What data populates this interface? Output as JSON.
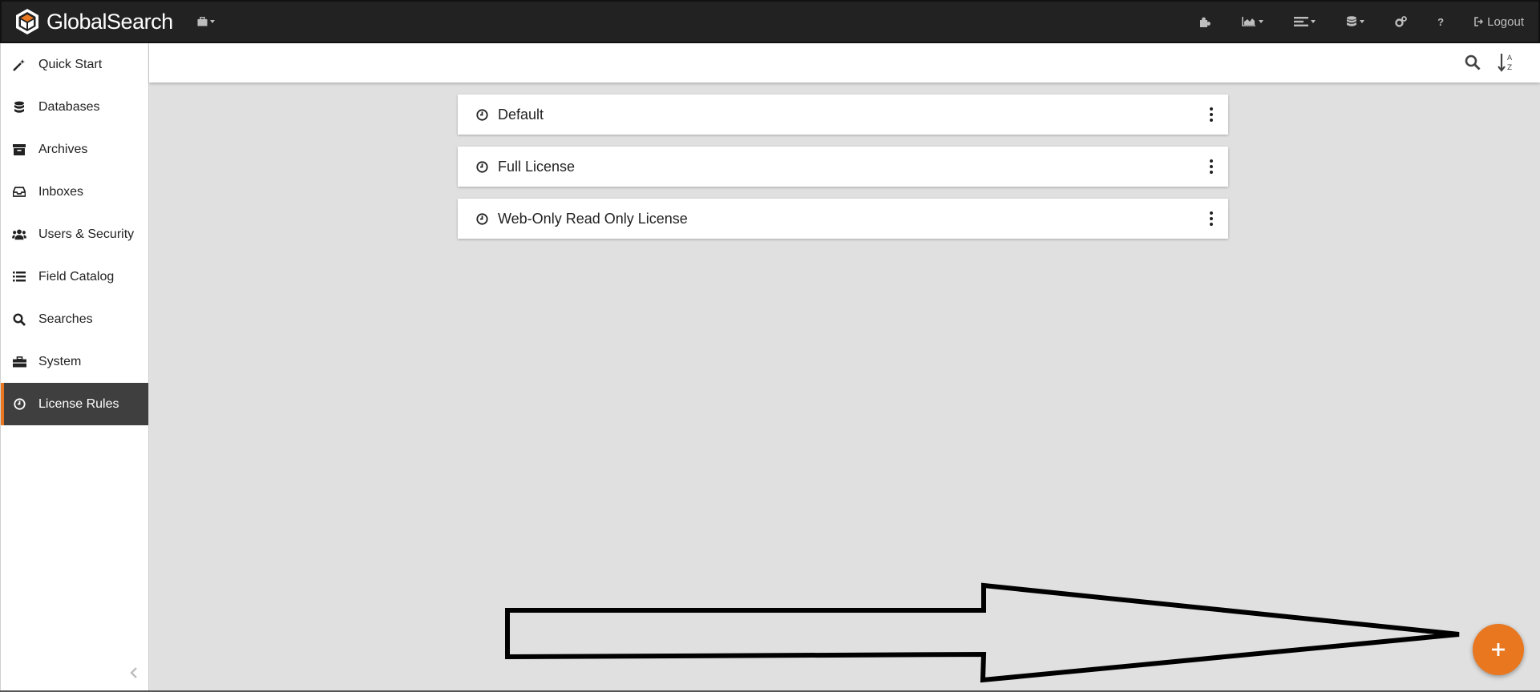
{
  "app": {
    "brand_name": "GlobalSearch",
    "brand_icon": "hexagon-box-logo",
    "accent_color": "#e8771f"
  },
  "topbar": {
    "lock_menu_icon": "briefcase-lock-icon",
    "actions": [
      {
        "icon": "puzzle-icon",
        "dropdown": false
      },
      {
        "icon": "area-chart-icon",
        "dropdown": true
      },
      {
        "icon": "list-columns-icon",
        "dropdown": true
      },
      {
        "icon": "database-icon",
        "dropdown": true
      },
      {
        "icon": "gears-icon",
        "dropdown": false
      },
      {
        "icon": "help-icon",
        "dropdown": false
      }
    ],
    "help_label": "?",
    "logout_label": "Logout"
  },
  "sidebar": {
    "items": [
      {
        "label": "Quick Start",
        "icon": "magic-wand-icon",
        "active": false
      },
      {
        "label": "Databases",
        "icon": "database-icon",
        "active": false
      },
      {
        "label": "Archives",
        "icon": "archive-box-icon",
        "active": false
      },
      {
        "label": "Inboxes",
        "icon": "inbox-tray-icon",
        "active": false
      },
      {
        "label": "Users & Security",
        "icon": "users-icon",
        "active": false
      },
      {
        "label": "Field Catalog",
        "icon": "list-icon",
        "active": false
      },
      {
        "label": "Searches",
        "icon": "search-icon",
        "active": false
      },
      {
        "label": "System",
        "icon": "briefcase-icon",
        "active": false
      },
      {
        "label": "License Rules",
        "icon": "clock-icon",
        "active": true
      }
    ],
    "collapse_icon": "chevron-left-icon"
  },
  "toolbar": {
    "search_icon": "search-icon",
    "sort_icon": "sort-alpha-icon",
    "sort_letters": [
      "A",
      "Z"
    ]
  },
  "rules": [
    {
      "name": "Default"
    },
    {
      "name": "Full License"
    },
    {
      "name": "Web-Only Read Only License"
    }
  ],
  "fab": {
    "icon": "plus-icon",
    "symbol": "+"
  }
}
